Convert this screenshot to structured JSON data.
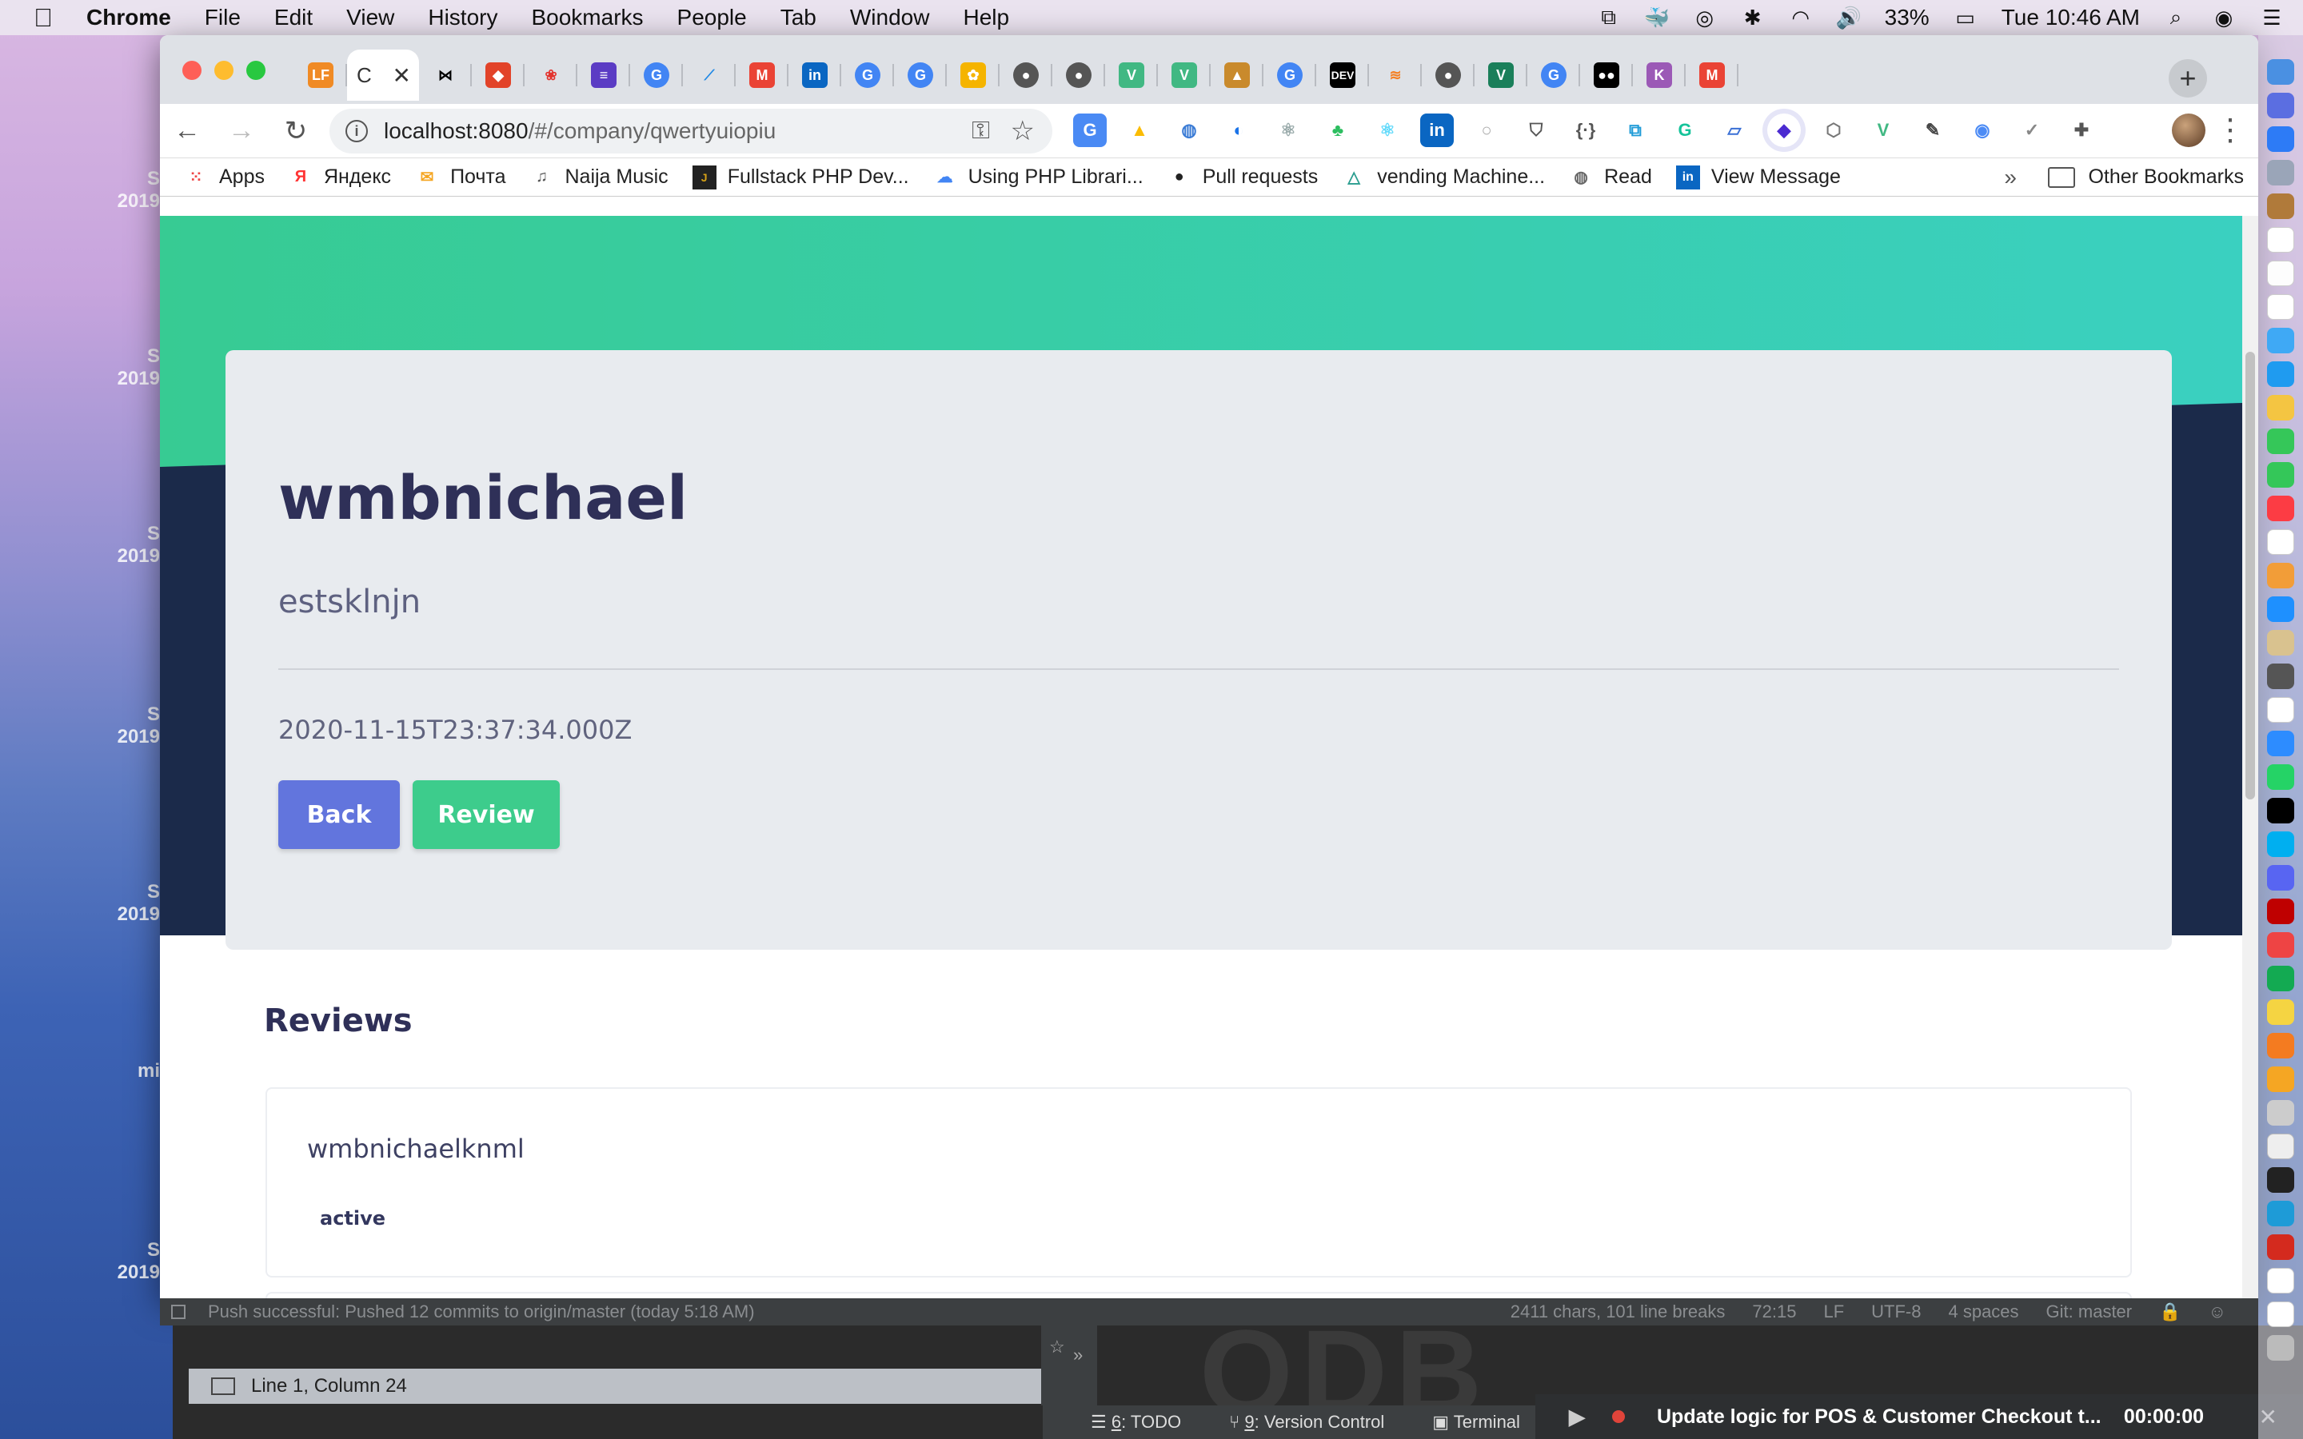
{
  "menubar": {
    "app": "Chrome",
    "items": [
      "File",
      "Edit",
      "View",
      "History",
      "Bookmarks",
      "People",
      "Tab",
      "Window",
      "Help"
    ],
    "battery": "33%",
    "clock": "Tue 10:46 AM"
  },
  "desktop": {
    "labels": [
      "S\n2019",
      "S\n2019",
      "S\n2019",
      "S\n2019",
      "S\n2019",
      "mi",
      "S\n2019"
    ]
  },
  "browser": {
    "active_tab_initial": "C",
    "tab_close": "✕",
    "new_tab": "+",
    "url_host": "localhost:8080",
    "url_path": "/#/company/qwertyuiopiu",
    "bookmarks": [
      "Apps",
      "Яндекс",
      "Почта",
      "Naija Music",
      "Fullstack PHP Dev...",
      "Using PHP Librari...",
      "Pull requests",
      "vending Machine...",
      "Read",
      "View Message"
    ],
    "bookmarks_more": "»",
    "other_bookmarks": "Other Bookmarks"
  },
  "page": {
    "company_name": "wmbnichael",
    "company_description": "estsklnjn",
    "company_date": "2020-11-15T23:37:34.000Z",
    "back_label": "Back",
    "review_label": "Review",
    "reviews_title": "Reviews",
    "reviews": [
      {
        "author": "wmbnichaelknml",
        "status": "active"
      }
    ],
    "colors": {
      "hero_top": "#37cb93",
      "hero_bottom": "#1b2a4a",
      "back_button": "#6275dd",
      "review_button": "#3dcc8c",
      "title": "#2f3058"
    }
  },
  "ide": {
    "status_message": "Push successful: Pushed 12 commits to origin/master (today 5:18 AM)",
    "chars": "2411 chars, 101 line breaks",
    "position": "72:15",
    "line_ending": "LF",
    "encoding": "UTF-8",
    "indent": "4 spaces",
    "git": "Git: master",
    "cursor": "Line 1, Column 24",
    "tool_todo_num": "6",
    "tool_todo": ": TODO",
    "tool_vc_num": "9",
    "tool_vc": ": Version Control",
    "tool_terminal": "Terminal",
    "task": "Update logic for POS & Customer Checkout t...",
    "timer": "00:00:00"
  }
}
